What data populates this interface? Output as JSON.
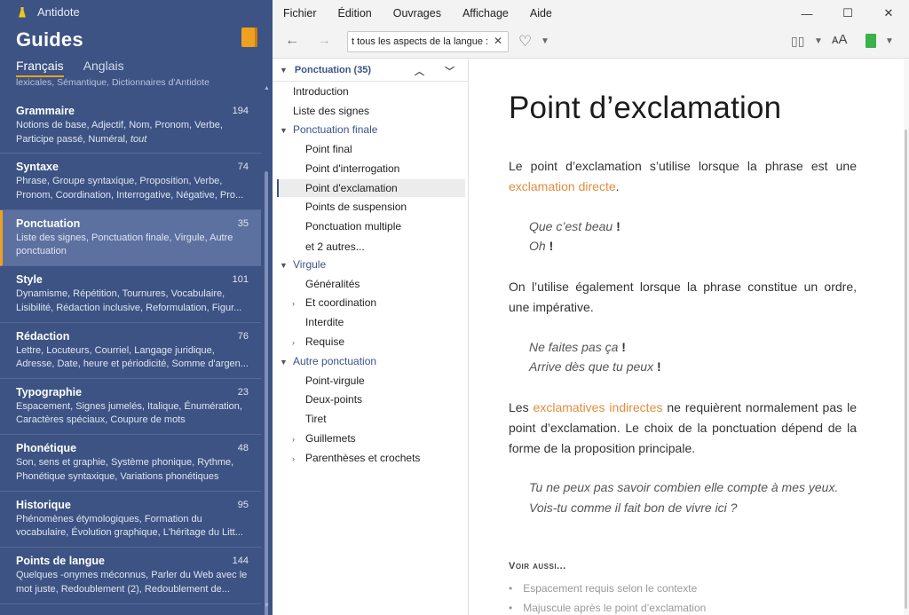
{
  "app": {
    "name": "Antidote",
    "section_title": "Guides"
  },
  "lang_tabs": [
    {
      "label": "Français",
      "active": true
    },
    {
      "label": "Anglais",
      "active": false
    }
  ],
  "sidebar_partial": "lexicales, Sémantique, Dictionnaires d'Antidote",
  "topics": [
    {
      "name": "Grammaire",
      "count": "194",
      "desc": "Notions de base, Adjectif, Nom, Pronom, Verbe, Participe passé, Numéral, tout",
      "desc_em": "tout"
    },
    {
      "name": "Syntaxe",
      "count": "74",
      "desc": "Phrase, Groupe syntaxique, Proposition, Verbe, Pronom, Coordination, Interrogative, Négative, Pro..."
    },
    {
      "name": "Ponctuation",
      "count": "35",
      "desc": "Liste des signes, Ponctuation finale, Virgule, Autre ponctuation",
      "active": true
    },
    {
      "name": "Style",
      "count": "101",
      "desc": "Dynamisme, Répétition, Tournures, Vocabulaire, Lisibilité, Rédaction inclusive, Reformulation, Figur..."
    },
    {
      "name": "Rédaction",
      "count": "76",
      "desc": "Lettre, Locuteurs, Courriel, Langage juridique, Adresse, Date, heure et périodicité, Somme d'argen..."
    },
    {
      "name": "Typographie",
      "count": "23",
      "desc": "Espacement, Signes jumelés, Italique, Énumération, Caractères spéciaux, Coupure de mots"
    },
    {
      "name": "Phonétique",
      "count": "48",
      "desc": "Son, sens et graphie, Système phonique, Rythme, Phonétique syntaxique, Variations phonétiques"
    },
    {
      "name": "Historique",
      "count": "95",
      "desc": "Phénomènes étymologiques, Formation du vocabulaire, Évolution graphique, L'héritage du Litt..."
    },
    {
      "name": "Points de langue",
      "count": "144",
      "desc": "Quelques -onymes méconnus, Parler du Web avec le mot juste, Redoublement (2), Redoublement de..."
    }
  ],
  "menu": [
    "Fichier",
    "Édition",
    "Ouvrages",
    "Affichage",
    "Aide"
  ],
  "search": {
    "value": "t tous les aspects de la langue :"
  },
  "tree": {
    "header": "Ponctuation (35)",
    "items": [
      {
        "label": "Introduction"
      },
      {
        "label": "Liste des signes"
      },
      {
        "label": "Ponctuation finale"
      },
      {
        "label": "Point final"
      },
      {
        "label": "Point d'interrogation"
      },
      {
        "label": "Point d'exclamation"
      },
      {
        "label": "Points de suspension"
      },
      {
        "label": "Ponctuation multiple"
      },
      {
        "label": "et 2 autres..."
      },
      {
        "label": "Virgule"
      },
      {
        "label": "Généralités"
      },
      {
        "label": "Et coordination"
      },
      {
        "label": "Interdite"
      },
      {
        "label": "Requise"
      },
      {
        "label": "Autre ponctuation"
      },
      {
        "label": "Point-virgule"
      },
      {
        "label": "Deux-points"
      },
      {
        "label": "Tiret"
      },
      {
        "label": "Guillemets"
      },
      {
        "label": "Parenthèses et crochets"
      }
    ]
  },
  "article": {
    "title": "Point d’exclamation",
    "p1_text": "Le point d’exclamation s’utilise lorsque la phrase est une ",
    "p1_link": "exclamation directe",
    "p1_end": ".",
    "ex1": [
      {
        "text": "Que c’est beau ",
        "mark": "!"
      },
      {
        "text": "Oh ",
        "mark": "!"
      }
    ],
    "p2_text": "On l’utilise également lorsque la phrase constitue un ordre, une impérative.",
    "ex2": [
      {
        "text": "Ne faites pas ça ",
        "mark": "!"
      },
      {
        "text": "Arrive dès que tu peux ",
        "mark": "!"
      }
    ],
    "p3_start": "Les ",
    "p3_link": "exclamatives indirectes",
    "p3_end": " ne requièrent normalement pas le point d’exclamation. Le choix de la ponctuation dépend de la forme de la proposition principale.",
    "ex3": [
      "Tu ne peux pas savoir combien elle compte à mes yeux.",
      "Vois-tu comme il fait bon de vivre ici ?"
    ],
    "see_also_title": "Voir aussi...",
    "see_also": [
      "Espacement requis selon le contexte",
      "Majuscule après le point d’exclamation"
    ]
  }
}
